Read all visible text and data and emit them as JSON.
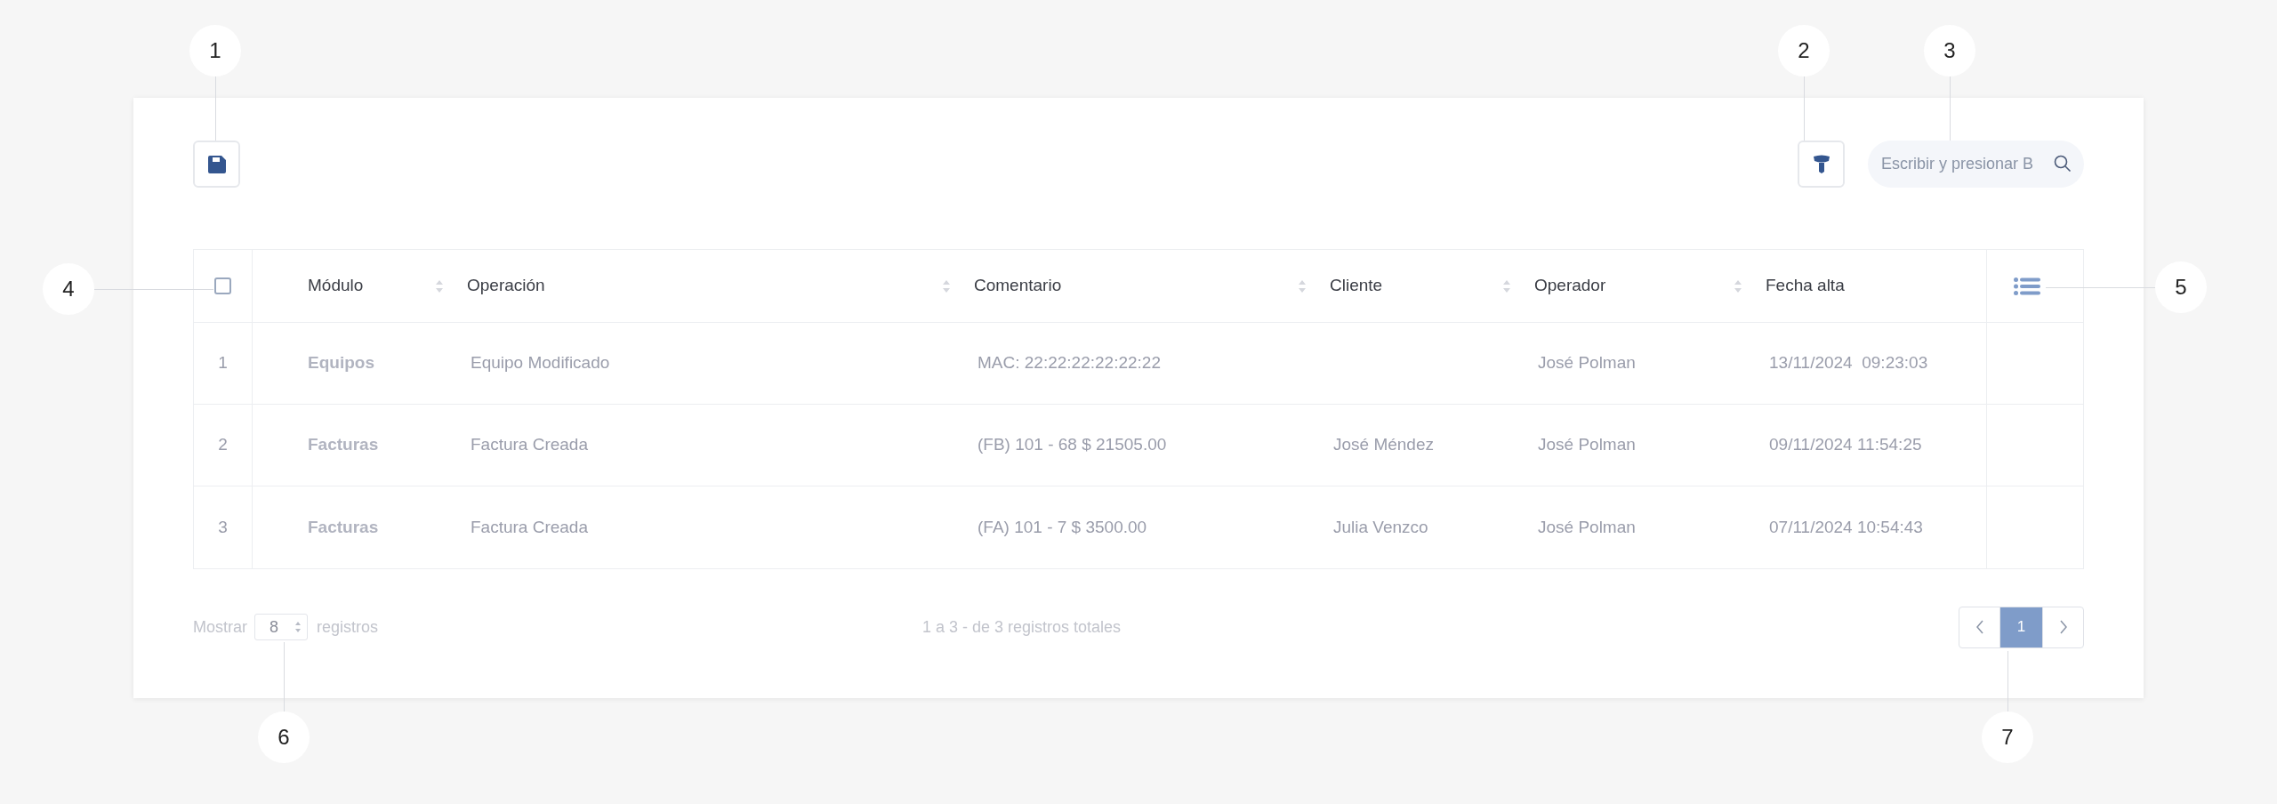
{
  "toolbar": {
    "search": {
      "placeholder": "Escribir y presionar B"
    }
  },
  "table": {
    "select_all": {
      "checked": false
    },
    "columns": [
      {
        "label": "Módulo",
        "sortable": true
      },
      {
        "label": "Operación",
        "sortable": true
      },
      {
        "label": "Comentario",
        "sortable": true
      },
      {
        "label": "Cliente",
        "sortable": true
      },
      {
        "label": "Operador",
        "sortable": true
      },
      {
        "label": "Fecha alta",
        "sortable": false
      }
    ],
    "rows": [
      {
        "number": "1",
        "module": "Equipos",
        "operation": "Equipo Modificado",
        "comment": "MAC: 22:22:22:22:22:22",
        "operator": "José Polman",
        "date": "13/11/2024  09:23:03"
      },
      {
        "number": "2",
        "module": "Facturas",
        "operation": "Factura Creada",
        "comment": "(FB) 101 - 68 $ 21505.00",
        "client": "José Méndez",
        "operator": "José Polman",
        "date": "09/11/2024 11:54:25"
      },
      {
        "number": "3",
        "module": "Facturas",
        "operation": "Factura Creada",
        "comment": "(FA) 101 - 7 $ 3500.00",
        "client": "Julia Venzco",
        "operator": "José Polman",
        "date": "07/11/2024 10:54:43"
      }
    ]
  },
  "footer": {
    "show_label": "Mostrar",
    "page_size": "8",
    "records_label": "registros",
    "summary": "1 a 3 - de 3 registros totales",
    "pages": [
      {
        "label": "1",
        "selected": true
      }
    ]
  },
  "annotations": [
    {
      "label": "1"
    },
    {
      "label": "2"
    },
    {
      "label": "3"
    },
    {
      "label": "4"
    },
    {
      "label": "5"
    },
    {
      "label": "6"
    },
    {
      "label": "7"
    }
  ]
}
